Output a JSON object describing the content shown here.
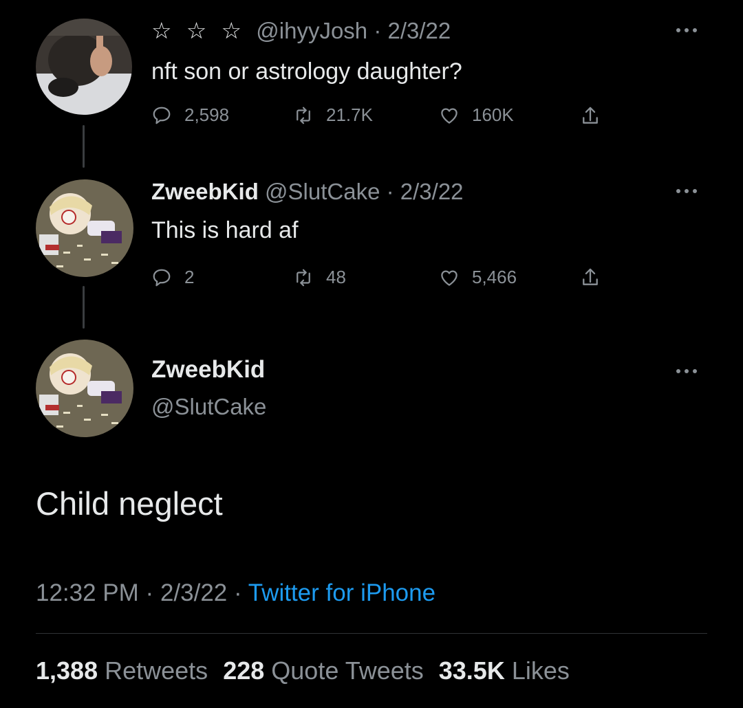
{
  "tweets": [
    {
      "stars": "☆ ☆ ☆",
      "handle": "@ihyyJosh",
      "separator": "·",
      "date": "2/3/22",
      "text": "nft son or astrology daughter?",
      "replies": "2,598",
      "retweets": "21.7K",
      "likes": "160K"
    },
    {
      "name": "ZweebKid",
      "handle": "@SlutCake",
      "separator": "·",
      "date": "2/3/22",
      "text": "This is hard af",
      "replies": "2",
      "retweets": "48",
      "likes": "5,466"
    }
  ],
  "main": {
    "name": "ZweebKid",
    "handle": "@SlutCake",
    "text": "Child neglect",
    "time": "12:32 PM",
    "separator": "·",
    "date": "2/3/22",
    "source": "Twitter for iPhone",
    "retweets_count": "1,388",
    "retweets_label": "Retweets",
    "quotes_count": "228",
    "quotes_label": "Quote Tweets",
    "likes_count": "33.5K",
    "likes_label": "Likes"
  },
  "icons": {
    "reply": "reply-icon",
    "retweet": "retweet-icon",
    "like": "heart-icon",
    "share": "share-icon",
    "more": "more-icon"
  },
  "colors": {
    "background": "#000000",
    "text_primary": "#e7e9ea",
    "text_secondary": "#8b9197",
    "link": "#1d9bf0",
    "divider": "#2f3336"
  }
}
